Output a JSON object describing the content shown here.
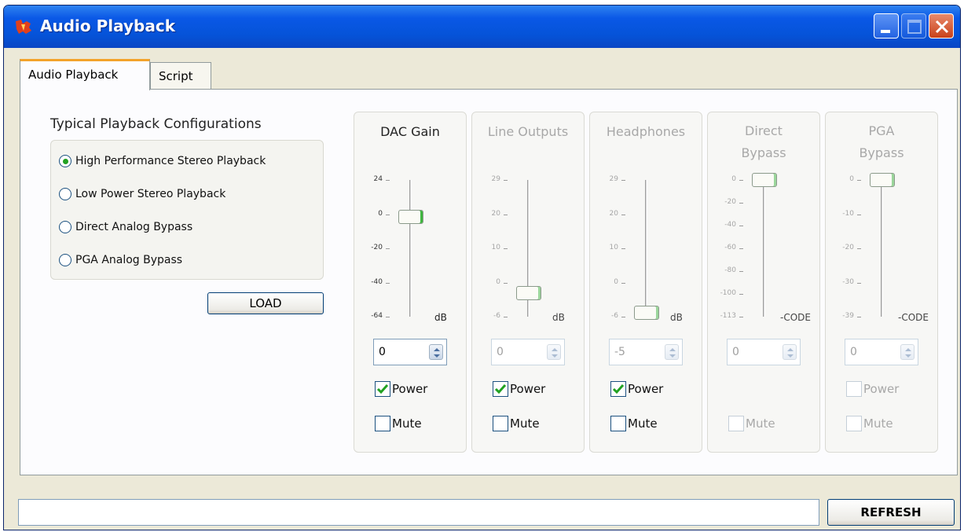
{
  "window": {
    "title": "Audio Playback"
  },
  "tabs": [
    {
      "label": "Audio Playback",
      "active": true
    },
    {
      "label": "Script",
      "active": false
    }
  ],
  "config": {
    "title": "Typical Playback Configurations",
    "options": [
      {
        "label": "High Performance Stereo Playback",
        "selected": true
      },
      {
        "label": "Low Power Stereo Playback",
        "selected": false
      },
      {
        "label": "Direct Analog Bypass",
        "selected": false
      },
      {
        "label": "PGA Analog Bypass",
        "selected": false
      }
    ],
    "load_label": "LOAD"
  },
  "strips": [
    {
      "title": "DAC Gain",
      "enabled": true,
      "ticks": [
        "24",
        "0",
        "-20",
        "-40",
        "-64"
      ],
      "unit": "dB",
      "level": 0.27,
      "value": "0",
      "power_label": "Power",
      "power_checked": true,
      "power_enabled": true,
      "mute_label": "Mute",
      "mute_checked": false,
      "mute_enabled": true
    },
    {
      "title": "Line Outputs",
      "enabled": false,
      "ticks": [
        "29",
        "20",
        "10",
        "0",
        "-6"
      ],
      "unit": "dB",
      "level": 0.83,
      "value": "0",
      "power_label": "Power",
      "power_checked": true,
      "power_enabled": true,
      "mute_label": "Mute",
      "mute_checked": false,
      "mute_enabled": true
    },
    {
      "title": "Headphones",
      "enabled": false,
      "ticks": [
        "29",
        "20",
        "10",
        "0",
        "-6"
      ],
      "unit": "dB",
      "level": 0.97,
      "value": "-5",
      "power_label": "Power",
      "power_checked": true,
      "power_enabled": true,
      "mute_label": "Mute",
      "mute_checked": false,
      "mute_enabled": true
    },
    {
      "title": "Direct Bypass",
      "enabled": false,
      "ticks": [
        "0",
        "-20",
        "-40",
        "-60",
        "-80",
        "-100",
        "-113"
      ],
      "unit": "-CODE",
      "level": 0.0,
      "value": "0",
      "power_label": "",
      "power_checked": false,
      "power_enabled": false,
      "mute_label": "Mute",
      "mute_checked": false,
      "mute_enabled": false
    },
    {
      "title": "PGA Bypass",
      "enabled": false,
      "ticks": [
        "0",
        "-10",
        "-20",
        "-30",
        "-39"
      ],
      "unit": "-CODE",
      "level": 0.0,
      "value": "0",
      "power_label": "Power",
      "power_checked": false,
      "power_enabled": false,
      "mute_label": "Mute",
      "mute_checked": false,
      "mute_enabled": false
    }
  ],
  "status": {
    "text": "",
    "refresh_label": "REFRESH"
  }
}
